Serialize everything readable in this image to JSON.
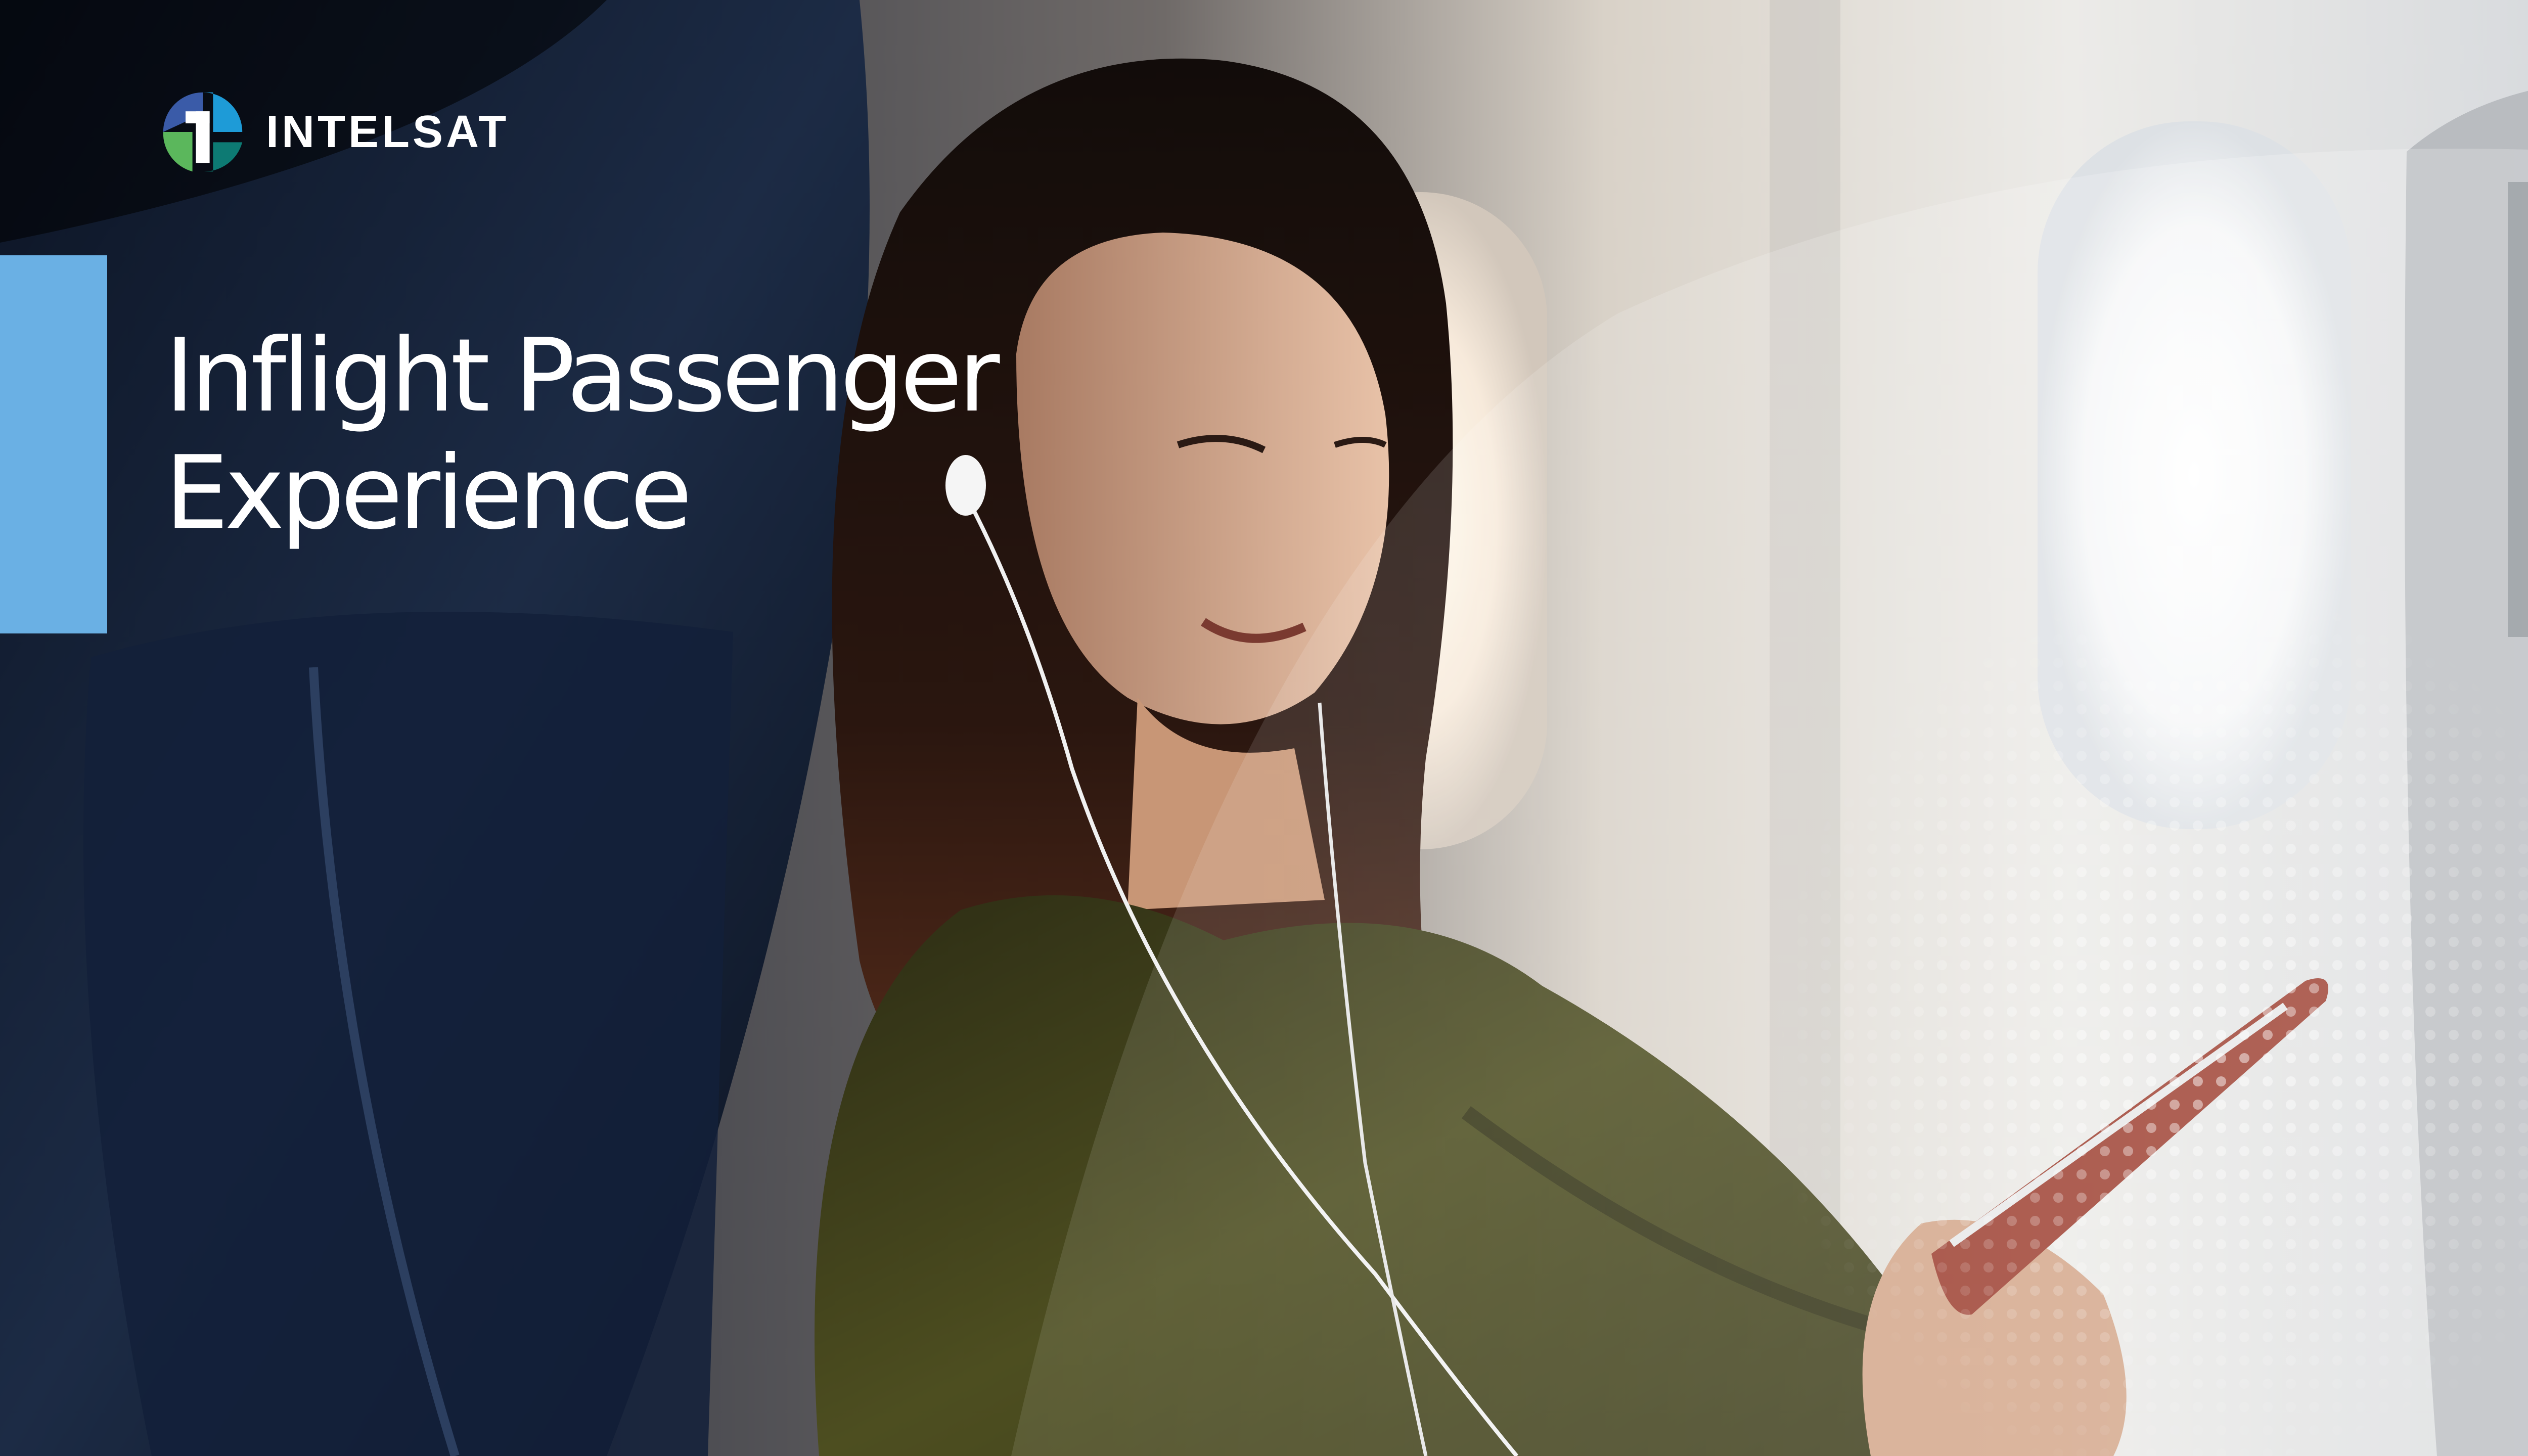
{
  "brand": {
    "name": "INTELSAT",
    "logo_icon": "intelsat-logo-icon",
    "logo_colors": [
      "#1e9bd7",
      "#3a5ba8",
      "#5bb75c",
      "#0d7a73"
    ]
  },
  "cover": {
    "title_line1": "Inflight Passenger",
    "title_line2": "Experience",
    "accent_color": "#6ab0e4",
    "photo": "airplane-passenger-photo"
  }
}
